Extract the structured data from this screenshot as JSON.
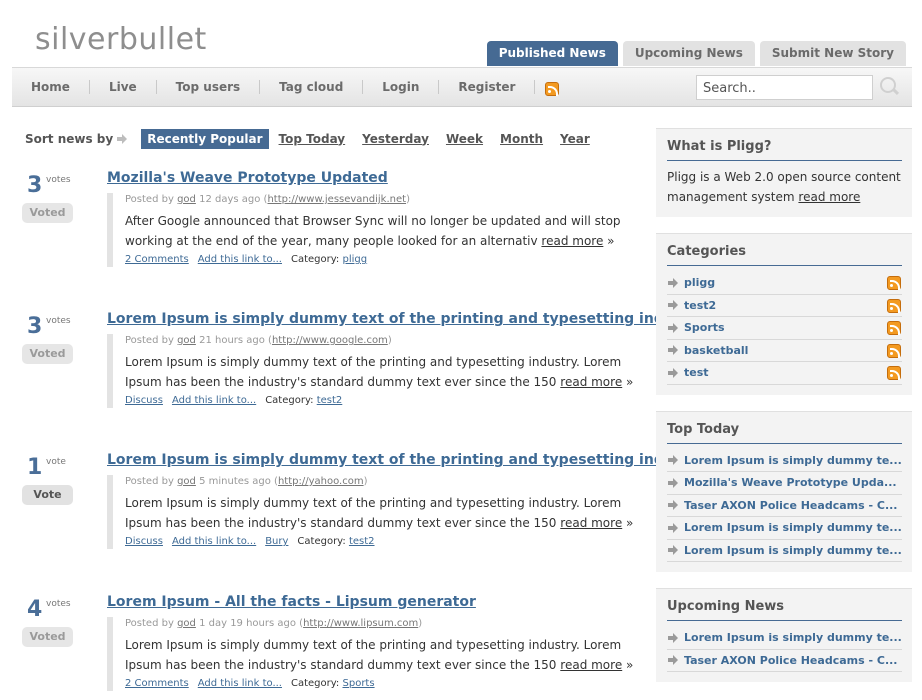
{
  "header": {
    "logo": "silverbullet",
    "tabs": [
      "Published News",
      "Upcoming News",
      "Submit New Story"
    ]
  },
  "nav": {
    "items": [
      "Home",
      "Live",
      "Top users",
      "Tag cloud",
      "Login",
      "Register"
    ],
    "rss_icon": "rss-icon",
    "search_placeholder": "Search.."
  },
  "sort": {
    "label": "Sort news by",
    "active": "Recently Popular",
    "options": [
      "Top Today",
      "Yesterday",
      "Week",
      "Month",
      "Year"
    ]
  },
  "stories": [
    {
      "votes": "3",
      "vote_word": "votes",
      "button": "Voted",
      "title": "Mozilla's Weave Prototype Updated",
      "posted_by": "Posted by",
      "author": "god",
      "ago": "12 days ago",
      "url": "http://www.jessevandijk.net",
      "excerpt": "After Google announced that Browser Sync will no longer be updated and will stop working at the end of the year, many people looked for an alternativ",
      "read_more": "read more",
      "links": [
        "2 Comments",
        "Add this link to..."
      ],
      "category_label": "Category:",
      "category": "pligg"
    },
    {
      "votes": "3",
      "vote_word": "votes",
      "button": "Voted",
      "title": "Lorem Ipsum is simply dummy text of the printing and typesetting industry.",
      "posted_by": "Posted by",
      "author": "god",
      "ago": "21 hours ago",
      "url": "http://www.google.com",
      "excerpt": "Lorem Ipsum is simply dummy text of the printing and typesetting industry. Lorem Ipsum has been the industry's standard dummy text ever since the 150",
      "read_more": "read more",
      "links": [
        "Discuss",
        "Add this link to..."
      ],
      "category_label": "Category:",
      "category": "test2"
    },
    {
      "votes": "1",
      "vote_word": "vote",
      "button": "Vote",
      "title": "Lorem Ipsum is simply dummy text of the printing and typesetting industry.",
      "posted_by": "Posted by",
      "author": "god",
      "ago": "5 minutes ago",
      "url": "http://yahoo.com",
      "excerpt": "Lorem Ipsum is simply dummy text of the printing and typesetting industry. Lorem Ipsum has been the industry's standard dummy text ever since the 150",
      "read_more": "read more",
      "links": [
        "Discuss",
        "Add this link to...",
        "Bury"
      ],
      "category_label": "Category:",
      "category": "test2"
    },
    {
      "votes": "4",
      "vote_word": "votes",
      "button": "Voted",
      "title": "Lorem Ipsum - All the facts - Lipsum generator",
      "posted_by": "Posted by",
      "author": "god",
      "ago": "1 day 19 hours ago",
      "url": "http://www.lipsum.com",
      "excerpt": "Lorem Ipsum is simply dummy text of the printing and typesetting industry. Lorem Ipsum has been the industry's standard dummy text ever since the 150",
      "read_more": "read more",
      "links": [
        "2 Comments",
        "Add this link to..."
      ],
      "category_label": "Category:",
      "category": "Sports"
    }
  ],
  "sidebar": {
    "about": {
      "title": "What is Pligg?",
      "text": "Pligg is a Web 2.0 open source content management system",
      "link": "read more"
    },
    "categories": {
      "title": "Categories",
      "items": [
        "pligg",
        "test2",
        "Sports",
        "basketball",
        "test"
      ]
    },
    "top_today": {
      "title": "Top Today",
      "items": [
        "Lorem Ipsum is simply dummy te...",
        "Mozilla's Weave Prototype Upda...",
        "Taser AXON Police Headcams - C...",
        "Lorem Ipsum is simply dummy te...",
        "Lorem Ipsum is simply dummy te..."
      ]
    },
    "upcoming": {
      "title": "Upcoming News",
      "items": [
        "Lorem Ipsum is simply dummy te...",
        "Taser AXON Police Headcams - C..."
      ]
    }
  }
}
